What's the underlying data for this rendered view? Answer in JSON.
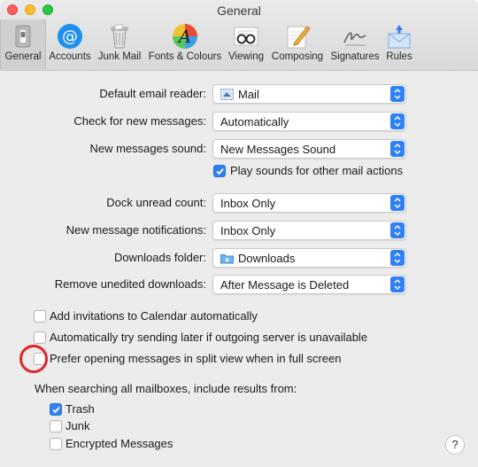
{
  "window": {
    "title": "General"
  },
  "toolbar": {
    "items": [
      {
        "label": "General",
        "icon": "general-switch-icon"
      },
      {
        "label": "Accounts",
        "icon": "at-sign-icon"
      },
      {
        "label": "Junk Mail",
        "icon": "trash-can-icon"
      },
      {
        "label": "Fonts & Colours",
        "icon": "font-palette-icon"
      },
      {
        "label": "Viewing",
        "icon": "glasses-icon"
      },
      {
        "label": "Composing",
        "icon": "pencil-paper-icon"
      },
      {
        "label": "Signatures",
        "icon": "signature-icon"
      },
      {
        "label": "Rules",
        "icon": "envelope-rules-icon"
      }
    ],
    "selected": "General"
  },
  "settings": {
    "default_email_reader": {
      "label": "Default email reader:",
      "value": "Mail",
      "icon": "stamp-icon"
    },
    "check_messages": {
      "label": "Check for new messages:",
      "value": "Automatically"
    },
    "new_messages_sound": {
      "label": "New messages sound:",
      "value": "New Messages Sound"
    },
    "play_sounds": {
      "label": "Play sounds for other mail actions",
      "checked": true
    },
    "dock_unread": {
      "label": "Dock unread count:",
      "value": "Inbox Only"
    },
    "notifications": {
      "label": "New message notifications:",
      "value": "Inbox Only"
    },
    "downloads_folder": {
      "label": "Downloads folder:",
      "value": "Downloads",
      "icon": "folder-icon"
    },
    "remove_downloads": {
      "label": "Remove unedited downloads:",
      "value": "After Message is Deleted"
    }
  },
  "options": [
    {
      "label": "Add invitations to Calendar automatically",
      "checked": false
    },
    {
      "label": "Automatically try sending later if outgoing server is unavailable",
      "checked": false
    },
    {
      "label": "Prefer opening messages in split view when in full screen",
      "checked": false
    }
  ],
  "search": {
    "heading": "When searching all mailboxes, include results from:",
    "items": [
      {
        "label": "Trash",
        "checked": true
      },
      {
        "label": "Junk",
        "checked": false
      },
      {
        "label": "Encrypted Messages",
        "checked": false
      }
    ]
  },
  "help": {
    "label": "?"
  },
  "colors": {
    "accent": "#2f7ff7",
    "annotation": "#e0242a"
  }
}
